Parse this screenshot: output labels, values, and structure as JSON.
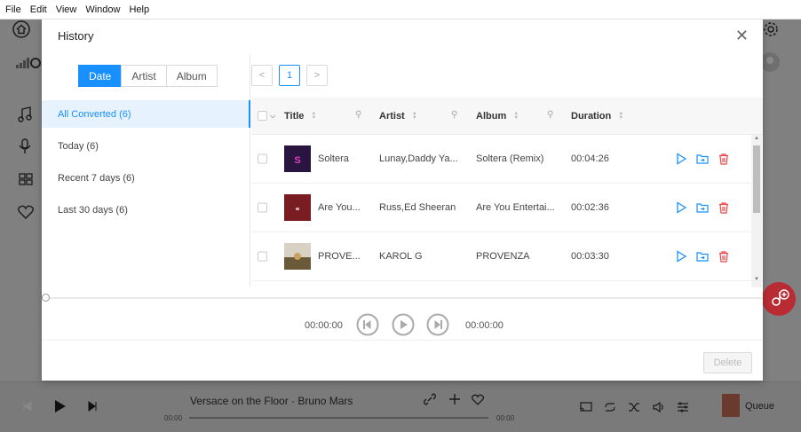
{
  "menubar": {
    "items": [
      "File",
      "Edit",
      "View",
      "Window",
      "Help"
    ]
  },
  "modal": {
    "title": "History",
    "close_icon": "close-icon",
    "segments": [
      {
        "label": "Date",
        "active": true
      },
      {
        "label": "Artist",
        "active": false
      },
      {
        "label": "Album",
        "active": false
      }
    ],
    "filters": [
      {
        "label": "All Converted (6)",
        "active": true
      },
      {
        "label": "Today (6)",
        "active": false
      },
      {
        "label": "Recent 7 days (6)",
        "active": false
      },
      {
        "label": "Last 30 days (6)",
        "active": false
      }
    ],
    "pager": {
      "prev": "<",
      "current": "1",
      "next": ">"
    },
    "table": {
      "columns": {
        "title": "Title",
        "artist": "Artist",
        "album": "Album",
        "duration": "Duration"
      },
      "rows": [
        {
          "title": "Soltera",
          "artist": "Lunay,Daddy Ya...",
          "album": "Soltera (Remix)",
          "duration": "00:04:26",
          "thumb_color": "#3a1f5c"
        },
        {
          "title": "Are You...",
          "artist": "Russ,Ed Sheeran",
          "album": "Are You Entertai...",
          "duration": "00:02:36",
          "thumb_color": "#7a1d22"
        },
        {
          "title": "PROVE...",
          "artist": "KAROL G",
          "album": "PROVENZA",
          "duration": "00:03:30",
          "thumb_color": "#a89a6a"
        }
      ]
    },
    "player": {
      "time_start": "00:00:00",
      "time_end": "00:00:00"
    },
    "delete_label": "Delete"
  },
  "background_player": {
    "track": "Versace on the Floor · Bruno Mars",
    "time_left": "00:00",
    "time_right": "00:00",
    "queue_label": "Queue"
  },
  "colors": {
    "accent": "#1890ff",
    "danger": "#e84848",
    "fab": "#b92c34"
  }
}
